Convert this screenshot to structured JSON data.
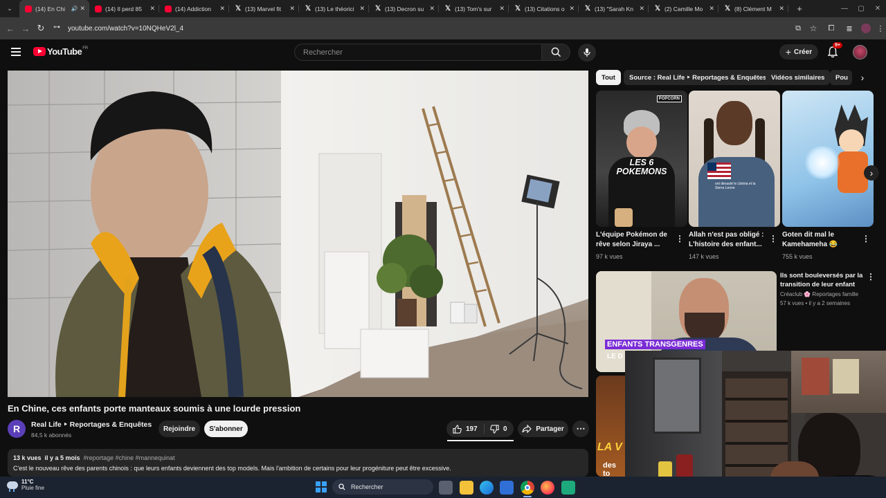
{
  "browser": {
    "tabs": [
      {
        "title": "(14) En Chi",
        "icon": "youtube",
        "active": true
      },
      {
        "title": "(14) Il perd 85",
        "icon": "youtube"
      },
      {
        "title": "(14) Addiction",
        "icon": "youtube"
      },
      {
        "title": "(13) Marvel fit",
        "icon": "x"
      },
      {
        "title": "(13) Le théorici",
        "icon": "x"
      },
      {
        "title": "(13) Decron su",
        "icon": "x"
      },
      {
        "title": "(13) Tom's sur",
        "icon": "x"
      },
      {
        "title": "(13) Citations o",
        "icon": "x"
      },
      {
        "title": "(13) \"Sarah Kn",
        "icon": "x"
      },
      {
        "title": "(2) Camille Mo",
        "icon": "x"
      },
      {
        "title": "(8) Clément M",
        "icon": "x"
      }
    ],
    "url": "youtube.com/watch?v=10NQHeV2l_4"
  },
  "youtube": {
    "logo_text": "YouTube",
    "logo_region": "FR",
    "search_placeholder": "Rechercher",
    "create_label": "Créer",
    "notif_count": "9+"
  },
  "video": {
    "title": "En Chine, ces enfants porte manteaux soumis à une lourde pression",
    "channel_name": "Real Life ‣ Reportages & Enquêtes",
    "channel_initial": "R",
    "subscribers": "84,5 k abonnés",
    "join_label": "Rejoindre",
    "subscribe_label": "S'abonner",
    "likes": "197",
    "dislikes": "0",
    "share_label": "Partager",
    "views": "13 k vues",
    "age": "il y a 5 mois",
    "hashtags": "#reportage #chine #mannequinat",
    "description": "C'est le nouveau rêve des parents chinois : que leurs enfants deviennent des top models. Mais l'ambition de certains pour leur progéniture peut être excessive."
  },
  "chips": [
    "Tout",
    "Source : Real Life ‣ Reportages & Enquêtes",
    "Vidéos similaires",
    "Pou"
  ],
  "shorts": [
    {
      "title": "L'équipe Pokémon de rêve selon Jiraya ...",
      "views": "97 k vues",
      "overlay": "LES 6 POKEMONS",
      "badge": "POPCORN"
    },
    {
      "title": "Allah n'est pas obligé : L'histoire des enfant...",
      "views": "147 k vues",
      "caption": "ont dévasté le Libéria et la Sierra Leone"
    },
    {
      "title": "Goten dit mal le Kamehameha 😂",
      "views": "755 k vues"
    }
  ],
  "recommended": {
    "title": "Ils sont bouleversés par la transition de leur enfant",
    "channel": "Créaclub 🌸 Reportages famille",
    "meta": "57 k vues • il y a 2 semaines",
    "thumb_caption": "ENFANTS TRANSGENRES",
    "thumb_sub": "LE D"
  },
  "partial_thumb_text": [
    "LA V",
    "des to"
  ],
  "taskbar": {
    "temperature": "11°C",
    "weather": "Pluie fine",
    "search_label": "Rechercher"
  }
}
